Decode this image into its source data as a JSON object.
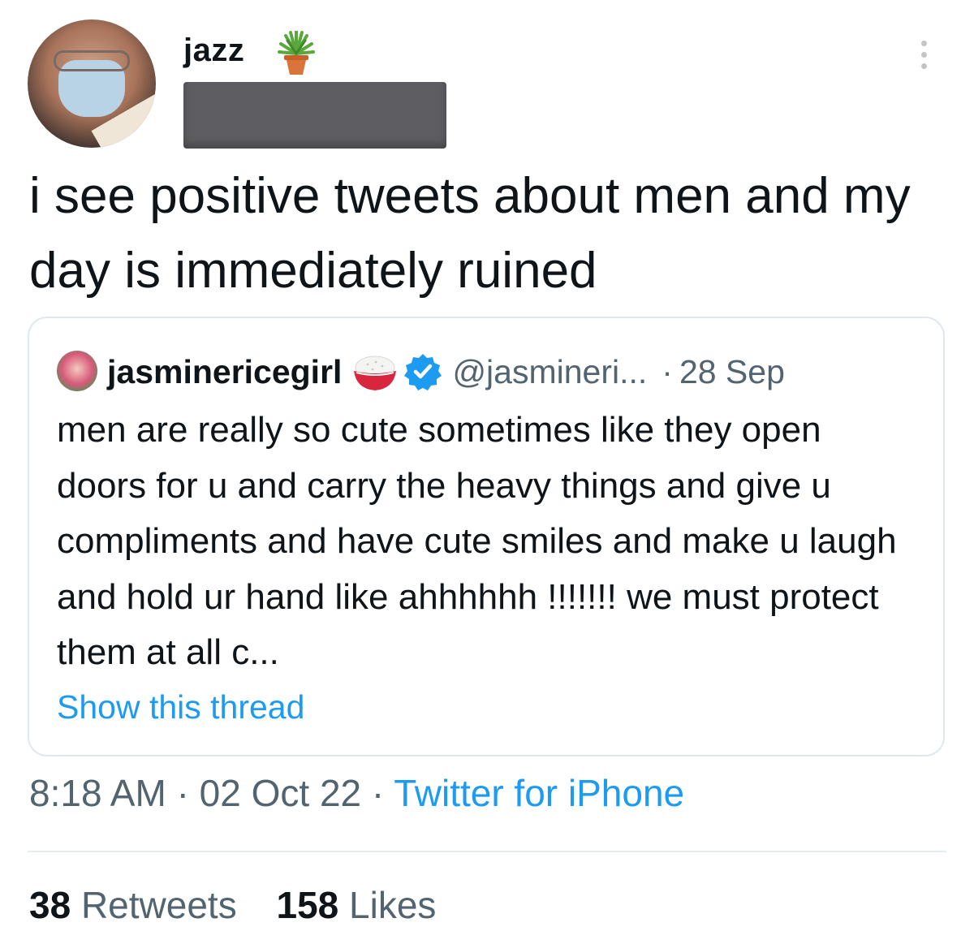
{
  "author": {
    "display_name": "jazz",
    "name_emoji": "potted-plant-icon"
  },
  "tweet": {
    "text": "i see positive tweets about men and my day is immediately ruined"
  },
  "quoted": {
    "display_name": "jasminericegirl",
    "name_emoji": "rice-bowl-icon",
    "verified": true,
    "handle": "@jasmineri...",
    "separator": "·",
    "date": "28 Sep",
    "text": "men are really so cute sometimes like they open doors for u and carry the heavy things and give u compliments and have cute smiles and make u laugh and hold ur hand like ahhhhhh !!!!!!! we must protect them at all c...",
    "show_thread": "Show this thread"
  },
  "meta": {
    "time": "8:18 AM",
    "sep1": "·",
    "date": "02 Oct 22",
    "sep2": "·",
    "source": "Twitter for iPhone"
  },
  "stats": {
    "retweets_count": "38",
    "retweets_label": "Retweets",
    "likes_count": "158",
    "likes_label": "Likes"
  },
  "colors": {
    "link": "#1d9bf0",
    "secondary_text": "#536471",
    "primary_text": "#0f1419",
    "quote_border": "#e1e8ed"
  }
}
